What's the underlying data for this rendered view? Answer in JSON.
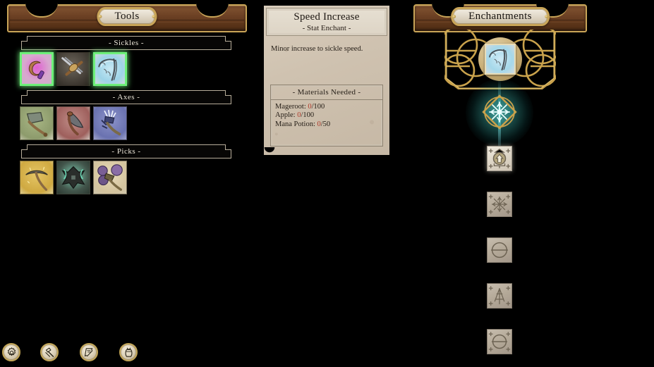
{
  "panels": {
    "tools": {
      "title": "Tools",
      "sections": [
        {
          "label": "- Sickles -",
          "items": [
            {
              "name": "sickle-magenta",
              "bg": "#d8a8cf",
              "selected": false
            },
            {
              "name": "sickle-iron",
              "bg": "#4a443d",
              "selected": false
            },
            {
              "name": "sickle-frost-vine",
              "bg": "#a9dced",
              "selected": true
            }
          ]
        },
        {
          "label": "- Axes -",
          "items": [
            {
              "name": "axe-stone-green",
              "bg": "#9aa877",
              "selected": false
            },
            {
              "name": "axe-crimson",
              "bg": "#b07d79",
              "selected": false
            },
            {
              "name": "axe-arcane-blue",
              "bg": "#7b82bd",
              "selected": false
            }
          ]
        },
        {
          "label": "- Picks -",
          "items": [
            {
              "name": "pick-gold",
              "bg": "#d8b552",
              "selected": false
            },
            {
              "name": "pick-obsidian",
              "bg": "#5a6b60",
              "selected": false
            },
            {
              "name": "pick-amethyst",
              "bg": "#ded0ad",
              "selected": false
            }
          ]
        }
      ]
    },
    "detail": {
      "title": "Speed Increase",
      "subtitle": "- Stat Enchant -",
      "description": "Minor increase to sickle speed.",
      "materials_header": "- Materials Needed -",
      "materials": [
        {
          "name": "Mageroot",
          "have": "0",
          "need": "/100"
        },
        {
          "name": "Apple",
          "have": "0",
          "need": "/100"
        },
        {
          "name": "Mana Potion",
          "have": "0",
          "need": "/50"
        }
      ]
    },
    "enchantments": {
      "title": "Enchantments",
      "selected_item": "sickle-frost-vine",
      "gem": "frost-rune-gem",
      "slots": [
        {
          "name": "rune-slot-upgrade",
          "glyph": "upgrade-arrow",
          "active": true
        },
        {
          "name": "rune-slot-starburst",
          "glyph": "starburst-rune",
          "active": false
        },
        {
          "name": "rune-slot-circle-line",
          "glyph": "circle-line-rune",
          "active": false
        },
        {
          "name": "rune-slot-arrow-anvil",
          "glyph": "arrow-anvil-rune",
          "active": false
        },
        {
          "name": "rune-slot-circle-line-2",
          "glyph": "circle-line-rune",
          "active": false
        }
      ]
    }
  },
  "hotbar": [
    {
      "name": "settings-button",
      "icon": "gear-icon"
    },
    {
      "name": "tools-button",
      "icon": "hammer-icon"
    },
    {
      "name": "journal-button",
      "icon": "scroll-icon"
    },
    {
      "name": "inventory-button",
      "icon": "pouch-icon"
    }
  ],
  "colors": {
    "selection": "#6ef07a",
    "gem_glow": "#7ff0e0",
    "gold": "#c9a558",
    "parchment": "#d4c8b6",
    "material_missing": "#b03a2a"
  }
}
